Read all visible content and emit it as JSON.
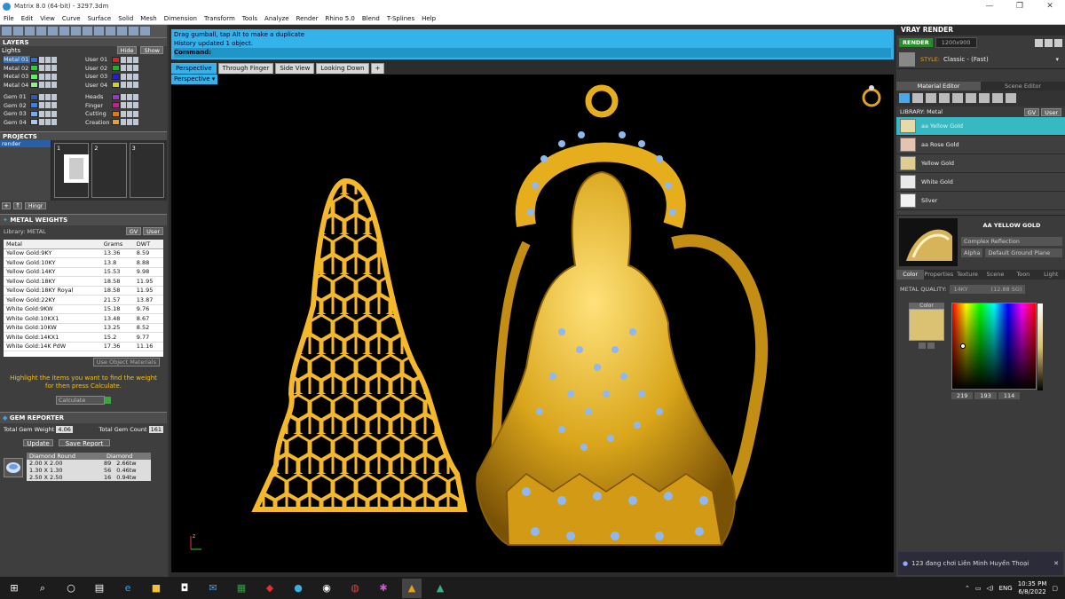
{
  "window": {
    "title": "Matrix 8.0 (64-bit) - 3297.3dm",
    "minimize": "—",
    "maximize": "❐",
    "close": "✕"
  },
  "menu": [
    "File",
    "Edit",
    "View",
    "Curve",
    "Surface",
    "Solid",
    "Mesh",
    "Dimension",
    "Transform",
    "Tools",
    "Analyze",
    "Render",
    "Rhino 5.0",
    "Blend",
    "T-Splines",
    "Help"
  ],
  "layers": {
    "title": "LAYERS",
    "lights": "Lights",
    "hide": "Hide",
    "show": "Show",
    "left": [
      {
        "name": "Metal 01",
        "color": "#2e6fd6"
      },
      {
        "name": "Metal 02",
        "color": "#2ecc40"
      },
      {
        "name": "Metal 03",
        "color": "#5ff05f"
      },
      {
        "name": "Metal 04",
        "color": "#8af08a"
      },
      {
        "name": "Gem 01",
        "color": "#2c5ab8"
      },
      {
        "name": "Gem 02",
        "color": "#3b7fe0"
      },
      {
        "name": "Gem 03",
        "color": "#7aa8f0"
      },
      {
        "name": "Gem 04",
        "color": "#a9c8f8"
      }
    ],
    "right": [
      {
        "name": "User 01",
        "color": "#e02020"
      },
      {
        "name": "User 02",
        "color": "#20b020"
      },
      {
        "name": "User 03",
        "color": "#2020d0"
      },
      {
        "name": "User 04",
        "color": "#d0d020"
      },
      {
        "name": "Heads",
        "color": "#9a35c8"
      },
      {
        "name": "Finger",
        "color": "#c02090"
      },
      {
        "name": "Cutting",
        "color": "#e07a10"
      },
      {
        "name": "Creation",
        "color": "#f0a020"
      }
    ]
  },
  "projects": {
    "title": "PROJECTS",
    "item": "render",
    "slots": [
      "1",
      "2",
      "3"
    ],
    "hinge": "Hingr"
  },
  "metal_weights": {
    "title": "METAL WEIGHTS",
    "library": "Library: METAL",
    "gv": "GV",
    "user": "User",
    "headers": [
      "Metal",
      "Grams",
      "DWT"
    ],
    "rows": [
      [
        "Yellow Gold:9KY",
        "13.36",
        "8.59"
      ],
      [
        "Yellow Gold:10KY",
        "13.8",
        "8.88"
      ],
      [
        "Yellow Gold:14KY",
        "15.53",
        "9.98"
      ],
      [
        "Yellow Gold:18KY",
        "18.58",
        "11.95"
      ],
      [
        "Yellow Gold:18KY Royal",
        "18.58",
        "11.95"
      ],
      [
        "Yellow Gold:22KY",
        "21.57",
        "13.87"
      ],
      [
        "White Gold:9KW",
        "15.18",
        "9.76"
      ],
      [
        "White Gold:10KX1",
        "13.48",
        "8.67"
      ],
      [
        "White Gold:10KW",
        "13.25",
        "8.52"
      ],
      [
        "White Gold:14KX1",
        "15.2",
        "9.77"
      ],
      [
        "White Gold:14K PdW",
        "17.36",
        "11.16"
      ]
    ],
    "use_object_materials": "Use Object Materials",
    "hint": "Highlight the items you want to find the weight for then press Calculate.",
    "calculate": "Calculate"
  },
  "gem_reporter": {
    "title": "GEM REPORTER",
    "total_weight_label": "Total Gem Weight",
    "total_weight": "4.06",
    "total_count_label": "Total Gem Count",
    "total_count": "161",
    "update": "Update",
    "save_report": "Save Report",
    "headers": [
      "Diamond Round",
      "Diamond"
    ],
    "rows": [
      [
        "2.00 X 2.00",
        "89",
        "2.66tw"
      ],
      [
        "1.30 X 1.30",
        "56",
        "0.46tw"
      ],
      [
        "2.50 X 2.50",
        "16",
        "0.94tw"
      ]
    ]
  },
  "command": {
    "line1": "Drag gumball, tap Alt to make a duplicate",
    "line2": "History updated 1 object.",
    "prompt": "Command:"
  },
  "tabs": [
    "Perspective",
    "Through Finger",
    "Side View",
    "Looking Down",
    "+"
  ],
  "viewport": {
    "label": "Perspective"
  },
  "vray": {
    "title": "VRAY RENDER",
    "render": "RENDER",
    "size": "1200x900",
    "style_label": "STYLE:",
    "style": "Classic - (Fast)",
    "editor_tabs": [
      "Material Editor",
      "Scene Editor"
    ],
    "library": "LIBRARY: Metal",
    "gv": "GV",
    "user": "User",
    "materials": [
      "aa Yellow Gold",
      "aa Rose Gold",
      "Yellow Gold",
      "White Gold",
      "Silver"
    ],
    "selected_material": "AA YELLOW GOLD",
    "complex": "Complex Reflection",
    "alpha": "Alpha",
    "ground": "Default Ground Plane",
    "prop_tabs": [
      "Color",
      "Properties",
      "Texture",
      "Scene",
      "Toon",
      "Light"
    ],
    "metal_quality_label": "METAL QUALITY:",
    "metal_quality": "14KY",
    "metal_quality_val": "(12.88 SG)",
    "color_label": "Color",
    "rgb": [
      "219",
      "193",
      "114"
    ],
    "swatch": "#dbc172"
  },
  "notification": "123 đang chơi Liên Minh Huyền Thoại",
  "taskbar": {
    "lang": "ENG",
    "time": "10:35 PM",
    "date": "6/8/2022"
  }
}
